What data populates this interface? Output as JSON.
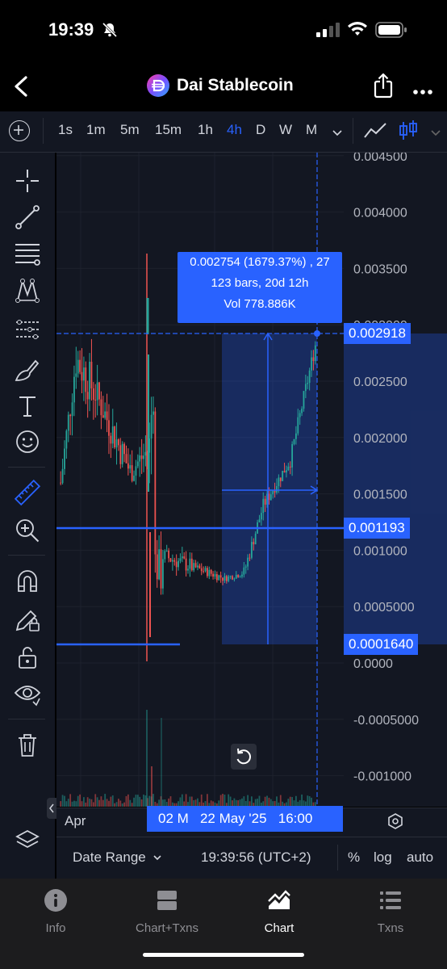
{
  "status_bar": {
    "time": "19:39"
  },
  "header": {
    "title": "Dai Stablecoin"
  },
  "toolbar": {
    "timeframes": [
      "1s",
      "1m",
      "5m",
      "15m",
      "1h",
      "4h",
      "D",
      "W",
      "M"
    ],
    "active_timeframe": "4h"
  },
  "price_axis": {
    "labels": [
      "0.004500",
      "0.004000",
      "0.003500",
      "0.003000",
      "0.002500",
      "0.002000",
      "0.001500",
      "0.001000",
      "0.0005000",
      "0.0000",
      "-0.0005000",
      "-0.001000"
    ],
    "badges": {
      "measure_top": "0.002918",
      "horizontal_line": "0.001193",
      "measure_bottom": "0.0001640"
    }
  },
  "measure_tooltip": {
    "line1": "0.002754 (1679.37%) , 27",
    "line2": "123 bars, 20d 12h",
    "line3": "Vol 778.886K"
  },
  "time_axis": {
    "left_label": "Apr",
    "crosshair_date": "02 M   22 May '25   16:00"
  },
  "bottom_bar": {
    "date_range": "Date Range",
    "clock": "19:39:56 (UTC+2)",
    "percent": "%",
    "log": "log",
    "auto": "auto"
  },
  "tabs": [
    {
      "label": "Info",
      "icon": "info-icon"
    },
    {
      "label": "Chart+Txns",
      "icon": "split-view-icon"
    },
    {
      "label": "Chart",
      "icon": "chart-icon",
      "active": true
    },
    {
      "label": "Txns",
      "icon": "list-icon"
    }
  ],
  "colors": {
    "accent": "#2962ff",
    "up": "#26a69a",
    "down": "#ef5350",
    "panel": "#131722"
  }
}
